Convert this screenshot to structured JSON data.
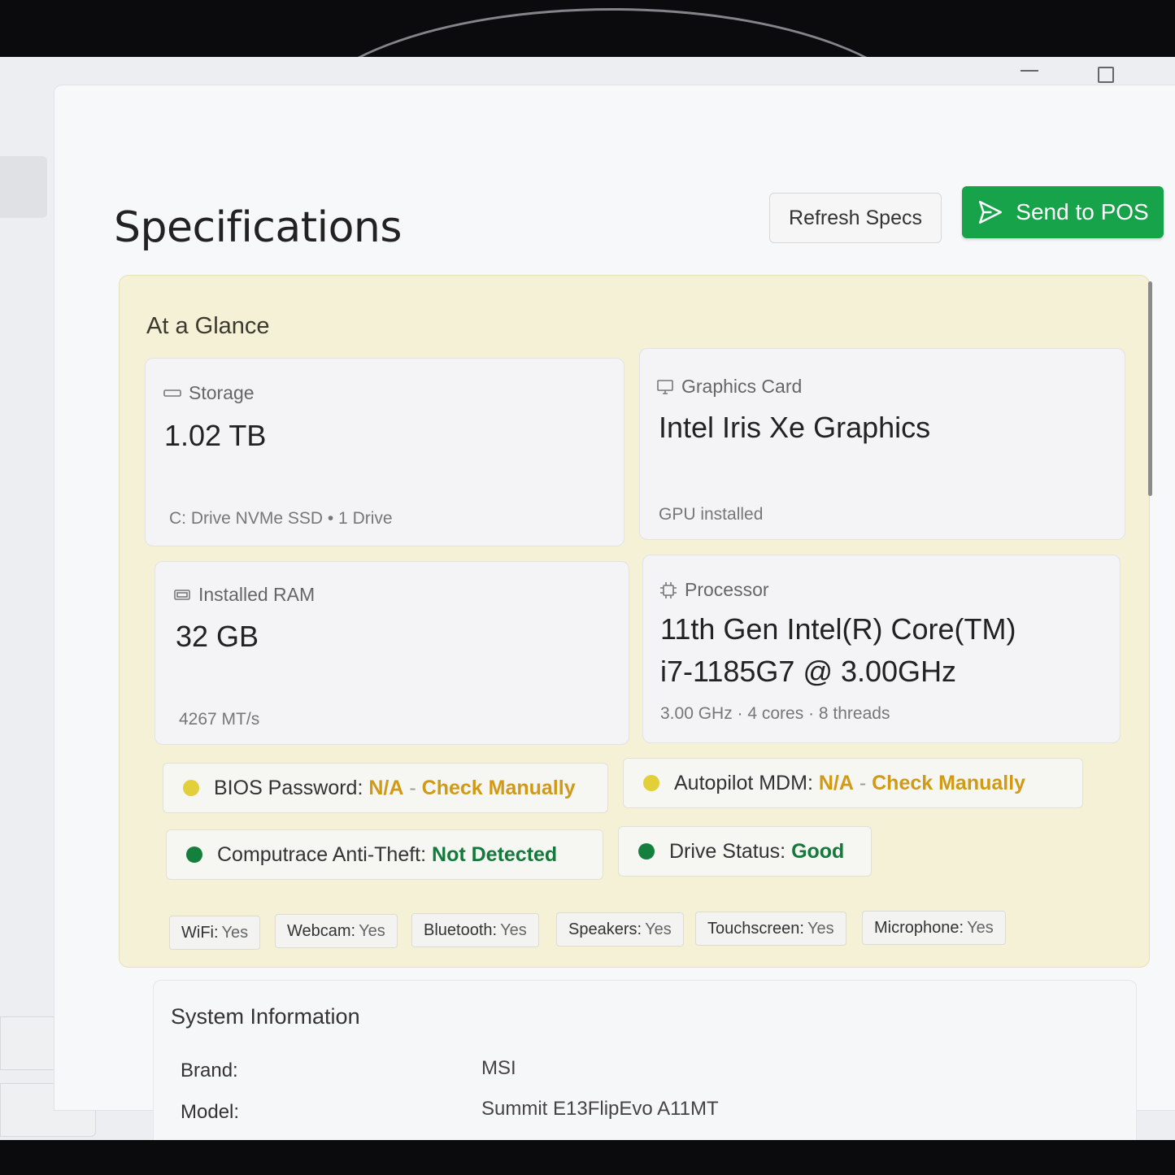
{
  "page": {
    "title": "Specifications"
  },
  "toolbar": {
    "refresh_label": "Refresh Specs",
    "send_label": "Send to POS"
  },
  "glance": {
    "title": "At a Glance",
    "storage": {
      "label": "Storage",
      "value": "1.02 TB",
      "sub": "C: Drive NVMe SSD • 1 Drive"
    },
    "graphics": {
      "label": "Graphics Card",
      "value": "Intel Iris Xe Graphics",
      "sub": "GPU installed"
    },
    "ram": {
      "label": "Installed RAM",
      "value": "32 GB",
      "sub": "4267 MT/s"
    },
    "processor": {
      "label": "Processor",
      "value_line1": "11th Gen Intel(R) Core(TM)",
      "value_line2": "i7-1185G7 @ 3.00GHz",
      "sub": "3.00 GHz · 4 cores · 8 threads"
    },
    "statuses": {
      "bios": {
        "label": "BIOS Password:",
        "value": "N/A",
        "sep": " - ",
        "note": "Check Manually"
      },
      "autopilot": {
        "label": "Autopilot MDM:",
        "value": "N/A",
        "sep": " - ",
        "note": "Check Manually"
      },
      "computrace": {
        "label": "Computrace Anti-Theft:",
        "value": "Not Detected"
      },
      "drive": {
        "label": "Drive Status:",
        "value": "Good"
      }
    },
    "features": [
      {
        "label": "WiFi:",
        "value": "Yes"
      },
      {
        "label": "Webcam:",
        "value": "Yes"
      },
      {
        "label": "Bluetooth:",
        "value": "Yes"
      },
      {
        "label": "Speakers:",
        "value": "Yes"
      },
      {
        "label": "Touchscreen:",
        "value": "Yes"
      },
      {
        "label": "Microphone:",
        "value": "Yes"
      }
    ]
  },
  "system_info": {
    "title": "System Information",
    "rows": [
      {
        "key": "Brand:",
        "value": "MSI"
      },
      {
        "key": "Model:",
        "value": "Summit E13FlipEvo A11MT"
      }
    ]
  },
  "colors": {
    "accent_green": "#16a34a",
    "warn_yellow": "#e3cf3a",
    "ok_green": "#15803d",
    "glance_bg": "#f5f1d6"
  },
  "icons": {
    "storage": "drive-icon",
    "graphics": "monitor-icon",
    "ram": "memory-icon",
    "processor": "chip-icon",
    "send": "send-icon"
  }
}
